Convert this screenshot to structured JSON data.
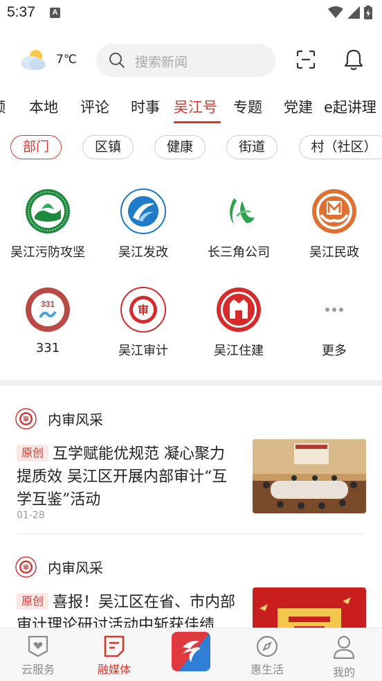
{
  "status_bar": {
    "time": "5:37",
    "notification_icon_letter": "A"
  },
  "header": {
    "weather_icon": "partly-cloudy-icon",
    "temperature": "7℃",
    "search_placeholder": "搜索新闻"
  },
  "tabs": {
    "partial_left": "频",
    "items": [
      "本地",
      "评论",
      "时事",
      "吴江号",
      "专题",
      "党建",
      "e起讲理"
    ],
    "active": "吴江号"
  },
  "chips": {
    "items": [
      "部门",
      "区镇",
      "健康",
      "街道",
      "村（社区）"
    ],
    "active": "部门"
  },
  "accounts": [
    {
      "label": "吴江污防攻坚",
      "icon": "environment-logo",
      "color": "#1e8a3e"
    },
    {
      "label": "吴江发改",
      "icon": "development-logo",
      "color": "#1f7ac8"
    },
    {
      "label": "长三角公司",
      "icon": "yangtze-logo",
      "color": "#2aa34a"
    },
    {
      "label": "吴江民政",
      "icon": "civil-affairs-logo",
      "color": "#e07030"
    },
    {
      "label": "331",
      "icon": "331-logo",
      "color": "#c0504d"
    },
    {
      "label": "吴江审计",
      "icon": "audit-logo",
      "color": "#d72a2a"
    },
    {
      "label": "吴江住建",
      "icon": "housing-logo",
      "color": "#d72a2a"
    },
    {
      "label": "更多",
      "icon": "more-icon",
      "color": "#999999"
    }
  ],
  "news": [
    {
      "source": "内审风采",
      "badge": "原创",
      "title": "互学赋能优规范 凝心聚力提质效 吴江区开展内部审计“互学互鉴”活动",
      "date": "01-28"
    },
    {
      "source": "内审风采",
      "badge": "原创",
      "title": "喜报！吴江区在省、市内部审计理论研讨活动中斩获佳绩",
      "date": ""
    }
  ],
  "bottom_nav": {
    "items": [
      {
        "label": "云服务",
        "icon": "heart-shield-icon"
      },
      {
        "label": "融媒体",
        "icon": "document-icon"
      },
      {
        "label": "惠生活",
        "icon": "compass-icon"
      },
      {
        "label": "我的",
        "icon": "user-icon"
      }
    ],
    "active": "融媒体",
    "center_icon": "app-logo-icon"
  },
  "colors": {
    "accent": "#d8372a",
    "badge_bg": "#fbe7e5"
  }
}
